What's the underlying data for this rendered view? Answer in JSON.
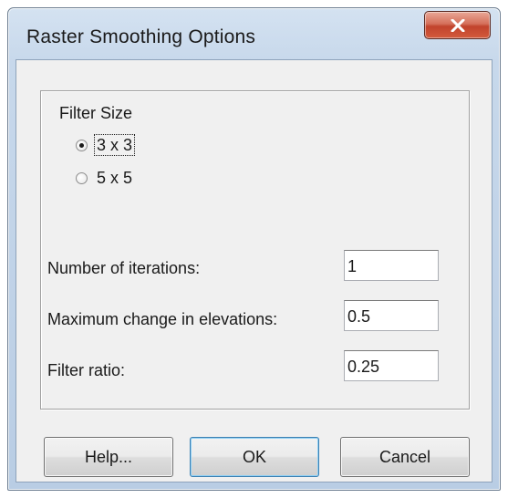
{
  "window": {
    "title": "Raster Smoothing Options",
    "close_icon": "close-x-icon",
    "close_color": "#c7503a"
  },
  "filter_size": {
    "label": "Filter Size",
    "options": [
      {
        "label": "3 x 3",
        "selected": true
      },
      {
        "label": "5 x 5",
        "selected": false
      }
    ]
  },
  "fields": {
    "iterations": {
      "label": "Number of iterations:",
      "value": "1"
    },
    "max_change": {
      "label": "Maximum change in elevations:",
      "value": "0.5"
    },
    "filter_ratio": {
      "label": "Filter ratio:",
      "value": "0.25"
    }
  },
  "buttons": {
    "help": "Help...",
    "ok": "OK",
    "cancel": "Cancel"
  }
}
